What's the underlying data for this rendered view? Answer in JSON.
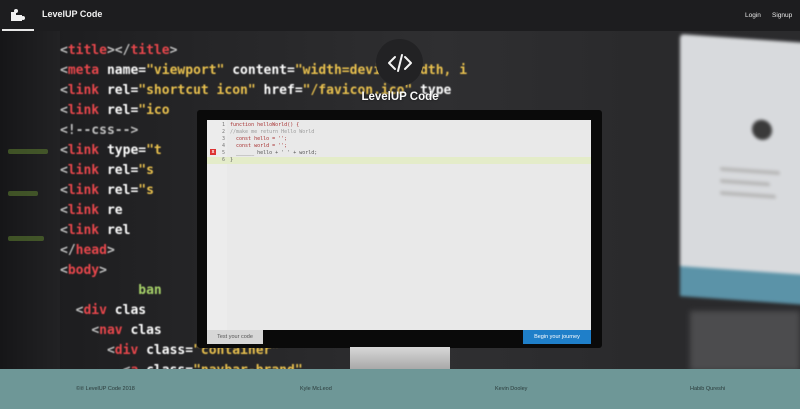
{
  "navbar": {
    "brand_icon": "puzzle-icon",
    "brand_title": "LevelUP Code",
    "links": [
      "Login",
      "Signup"
    ]
  },
  "hero": {
    "logo_icon": "code-brackets-icon",
    "title": "LevelUP Code"
  },
  "editor": {
    "lines": [
      {
        "num": "1",
        "text": "function helloWorld() {"
      },
      {
        "num": "2",
        "text": "//make me return Hello World"
      },
      {
        "num": "3",
        "text": "  const hello = '';"
      },
      {
        "num": "4",
        "text": "  const world = '';"
      },
      {
        "num": "5",
        "text": "  ______ hello + ' ' + world;"
      },
      {
        "num": "6",
        "text": "}"
      }
    ],
    "error_marker": "x"
  },
  "actions": {
    "test_label": "Test your code",
    "begin_label": "Begin your journey"
  },
  "footer": {
    "copyright": "©℗ LevelUP Code 2018",
    "authors": [
      "Kyle McLeod",
      "Kevin Dooley",
      "Habib Qureshi"
    ]
  },
  "colors": {
    "accent": "#1f7fc9",
    "footer_bg": "#6e9797",
    "navbar_bg": "#1d1d1f"
  }
}
